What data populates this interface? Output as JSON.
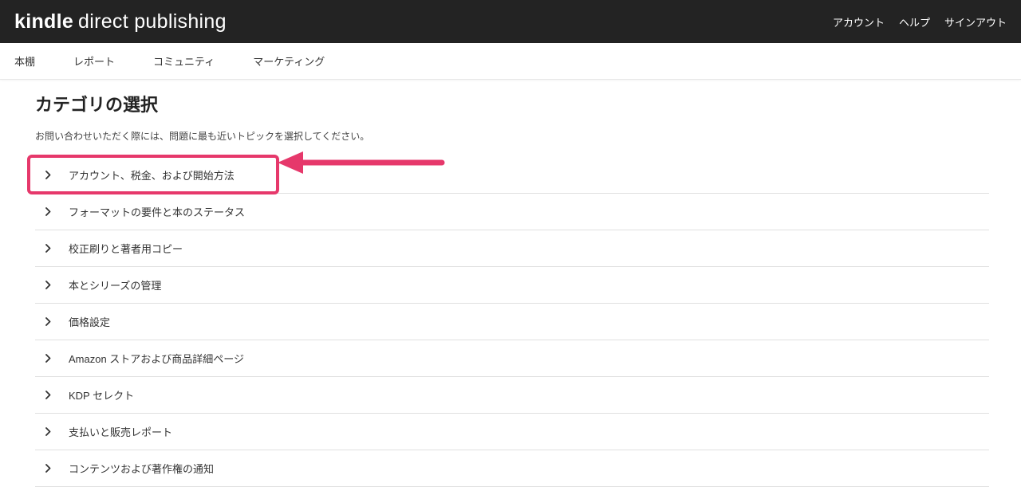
{
  "header": {
    "logo_kindle": "kindle",
    "logo_rest": "direct publishing",
    "links": {
      "account": "アカウント",
      "help": "ヘルプ",
      "signout": "サインアウト"
    }
  },
  "nav": {
    "bookshelf": "本棚",
    "reports": "レポート",
    "community": "コミュニティ",
    "marketing": "マーケティング"
  },
  "main": {
    "title": "カテゴリの選択",
    "subtitle": "お問い合わせいただく際には、問題に最も近いトピックを選択してください。",
    "categories": [
      "アカウント、税金、および開始方法",
      "フォーマットの要件と本のステータス",
      "校正刷りと著者用コピー",
      "本とシリーズの管理",
      "価格設定",
      "Amazon ストアおよび商品詳細ページ",
      "KDP セレクト",
      "支払いと販売レポート",
      "コンテンツおよび著作権の通知"
    ]
  },
  "annotation": {
    "highlight_color": "#e6386b"
  }
}
